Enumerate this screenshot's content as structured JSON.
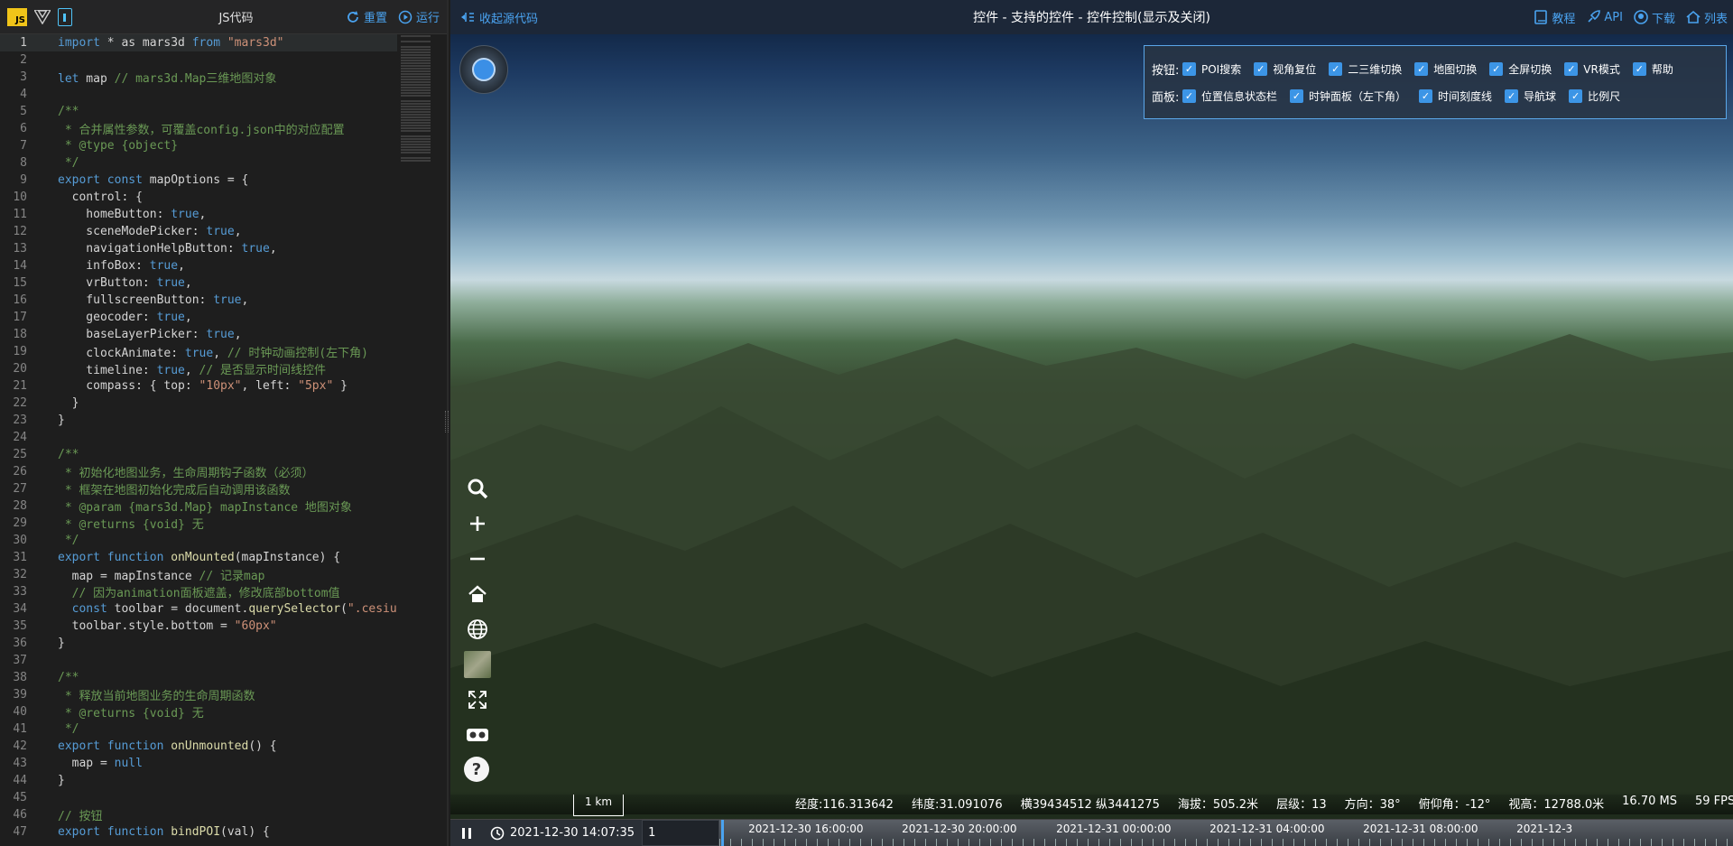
{
  "editor": {
    "title": "JS代码",
    "reset_label": "重置",
    "run_label": "运行",
    "lines": [
      {
        "n": "1",
        "html": "<span class=\"kw\">import</span> * as mars3d <span class=\"kw\">from</span> <span class=\"str\">\"mars3d\"</span>",
        "active": true
      },
      {
        "n": "2",
        "html": ""
      },
      {
        "n": "3",
        "html": "<span class=\"kw\">let</span> map <span class=\"cm\">// mars3d.Map三维地图对象</span>"
      },
      {
        "n": "4",
        "html": ""
      },
      {
        "n": "5",
        "html": "<span class=\"cm\">/**</span>"
      },
      {
        "n": "6",
        "html": "<span class=\"cm\"> * 合并属性参数，可覆盖config.json中的对应配置</span>"
      },
      {
        "n": "7",
        "html": "<span class=\"cm\"> * @type {object}</span>"
      },
      {
        "n": "8",
        "html": "<span class=\"cm\"> */</span>"
      },
      {
        "n": "9",
        "html": "<span class=\"kw\">export const</span> mapOptions = {"
      },
      {
        "n": "10",
        "html": "  control: {"
      },
      {
        "n": "11",
        "html": "    homeButton: <span class=\"kw\">true</span>,"
      },
      {
        "n": "12",
        "html": "    sceneModePicker: <span class=\"kw\">true</span>,"
      },
      {
        "n": "13",
        "html": "    navigationHelpButton: <span class=\"kw\">true</span>,"
      },
      {
        "n": "14",
        "html": "    infoBox: <span class=\"kw\">true</span>,"
      },
      {
        "n": "15",
        "html": "    vrButton: <span class=\"kw\">true</span>,"
      },
      {
        "n": "16",
        "html": "    fullscreenButton: <span class=\"kw\">true</span>,"
      },
      {
        "n": "17",
        "html": "    geocoder: <span class=\"kw\">true</span>,"
      },
      {
        "n": "18",
        "html": "    baseLayerPicker: <span class=\"kw\">true</span>,"
      },
      {
        "n": "19",
        "html": "    clockAnimate: <span class=\"kw\">true</span>, <span class=\"cm\">// 时钟动画控制(左下角)</span>"
      },
      {
        "n": "20",
        "html": "    timeline: <span class=\"kw\">true</span>, <span class=\"cm\">// 是否显示时间线控件</span>"
      },
      {
        "n": "21",
        "html": "    compass: { top: <span class=\"str\">\"10px\"</span>, left: <span class=\"str\">\"5px\"</span> }"
      },
      {
        "n": "22",
        "html": "  }"
      },
      {
        "n": "23",
        "html": "}"
      },
      {
        "n": "24",
        "html": ""
      },
      {
        "n": "25",
        "html": "<span class=\"cm\">/**</span>"
      },
      {
        "n": "26",
        "html": "<span class=\"cm\"> * 初始化地图业务，生命周期钩子函数（必须）</span>"
      },
      {
        "n": "27",
        "html": "<span class=\"cm\"> * 框架在地图初始化完成后自动调用该函数</span>"
      },
      {
        "n": "28",
        "html": "<span class=\"cm\"> * @param {mars3d.Map} mapInstance 地图对象</span>"
      },
      {
        "n": "29",
        "html": "<span class=\"cm\"> * @returns {void} 无</span>"
      },
      {
        "n": "30",
        "html": "<span class=\"cm\"> */</span>"
      },
      {
        "n": "31",
        "html": "<span class=\"kw\">export function</span> <span class=\"fn\">onMounted</span>(mapInstance) {"
      },
      {
        "n": "32",
        "html": "  map = mapInstance <span class=\"cm\">// 记录map</span>"
      },
      {
        "n": "33",
        "html": "  <span class=\"cm\">// 因为animation面板遮盖，修改底部bottom值</span>"
      },
      {
        "n": "34",
        "html": "  <span class=\"kw\">const</span> toolbar = document.<span class=\"fn\">querySelector</span>(<span class=\"str\">\".cesium</span>"
      },
      {
        "n": "35",
        "html": "  toolbar.style.bottom = <span class=\"str\">\"60px\"</span>"
      },
      {
        "n": "36",
        "html": "}"
      },
      {
        "n": "37",
        "html": ""
      },
      {
        "n": "38",
        "html": "<span class=\"cm\">/**</span>"
      },
      {
        "n": "39",
        "html": "<span class=\"cm\"> * 释放当前地图业务的生命周期函数</span>"
      },
      {
        "n": "40",
        "html": "<span class=\"cm\"> * @returns {void} 无</span>"
      },
      {
        "n": "41",
        "html": "<span class=\"cm\"> */</span>"
      },
      {
        "n": "42",
        "html": "<span class=\"kw\">export function</span> <span class=\"fn\">onUnmounted</span>() {"
      },
      {
        "n": "43",
        "html": "  map = <span class=\"kw\">null</span>"
      },
      {
        "n": "44",
        "html": "}"
      },
      {
        "n": "45",
        "html": ""
      },
      {
        "n": "46",
        "html": "<span class=\"cm\">// 按钮</span>"
      },
      {
        "n": "47",
        "html": "<span class=\"kw\">export function</span> <span class=\"fn\">bindPOI</span>(val) {"
      }
    ]
  },
  "map": {
    "collapse_label": "收起源代码",
    "title": "控件 - 支持的控件 - 控件控制(显示及关闭)",
    "links": {
      "tutorial": "教程",
      "api": "API",
      "download": "下载",
      "list": "列表"
    },
    "panel": {
      "buttons_label": "按钮:",
      "panels_label": "面板:",
      "buttons": [
        "POI搜索",
        "视角复位",
        "二三维切换",
        "地图切换",
        "全屏切换",
        "VR模式",
        "帮助"
      ],
      "panels": [
        "位置信息状态栏",
        "时钟面板（左下角）",
        "时间刻度线",
        "导航球",
        "比例尺"
      ]
    },
    "scale_label": "1 km",
    "status": {
      "lng": "经度:116.313642",
      "lat": "纬度:31.091076",
      "xy": "横39434512 纵3441275",
      "alt": "海拔：505.2米",
      "level": "层级：13",
      "heading": "方向：38°",
      "pitch": "俯仰角：-12°",
      "height": "视高：12788.0米",
      "ms": "16.70 MS",
      "fps": "59 FPS"
    },
    "timeline": {
      "clock": "2021-12-30 14:07:35",
      "speed": "1",
      "ticks": [
        "2021-12-30 16:00:00",
        "2021-12-30 20:00:00",
        "2021-12-31 00:00:00",
        "2021-12-31 04:00:00",
        "2021-12-31 08:00:00",
        "2021-12-3"
      ]
    }
  }
}
